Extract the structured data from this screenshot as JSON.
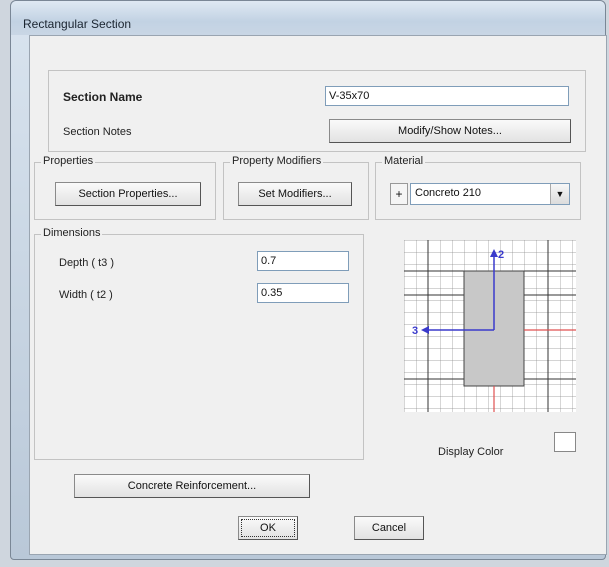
{
  "window": {
    "title": "Rectangular Section"
  },
  "section": {
    "name_label": "Section Name",
    "name_value": "V-35x70",
    "notes_label": "Section Notes",
    "notes_button": "Modify/Show Notes..."
  },
  "properties": {
    "title": "Properties",
    "button": "Section Properties..."
  },
  "modifiers": {
    "title": "Property Modifiers",
    "button": "Set Modifiers..."
  },
  "material": {
    "title": "Material",
    "plus": "+",
    "selected": "Concreto 210",
    "dropdown_icon": "▼"
  },
  "dimensions": {
    "title": "Dimensions",
    "depth_label": "Depth  ( t3 )",
    "depth_value": "0.7",
    "width_label": "Width  ( t2 )",
    "width_value": "0.35"
  },
  "preview": {
    "axis2_label": "2",
    "axis3_label": "3",
    "display_color_label": "Display Color",
    "section_fill": "#c8c8c8",
    "axis_color": "#3a3acc",
    "ref_color": "#e05050"
  },
  "buttons": {
    "reinforcement": "Concrete Reinforcement...",
    "ok": "OK",
    "cancel": "Cancel"
  }
}
